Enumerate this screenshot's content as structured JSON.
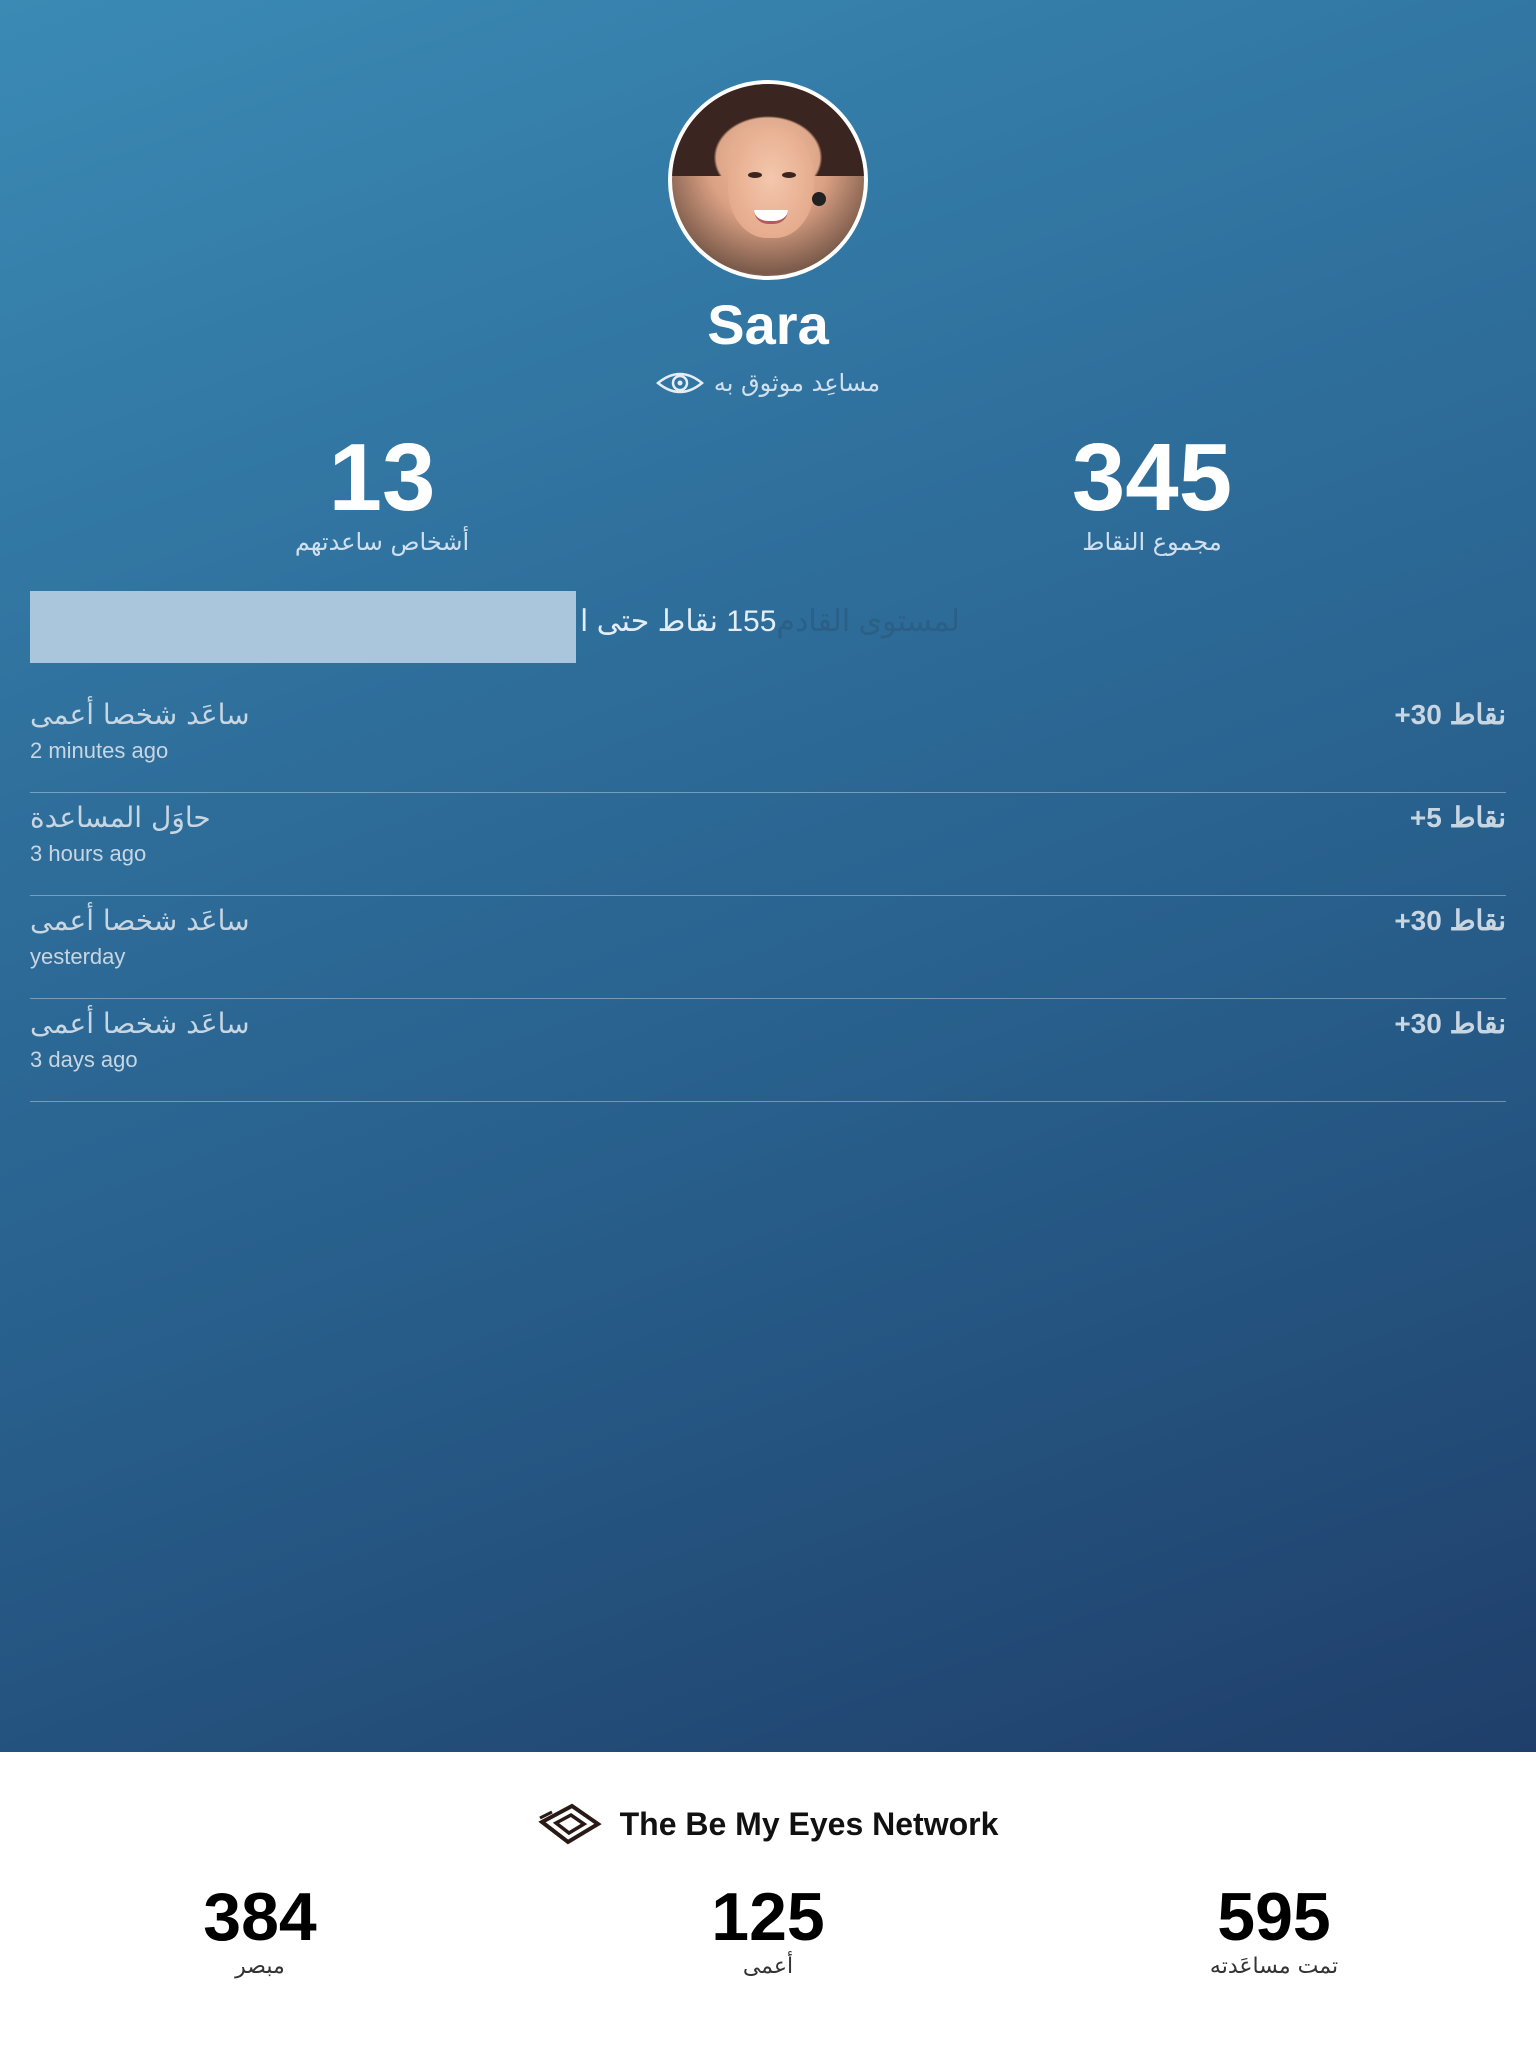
{
  "profile": {
    "name": "Sara",
    "role": "مساعِد موثوق به",
    "helped_count": "13",
    "helped_label": "أشخاص ساعدتهم",
    "points_total": "345",
    "points_label": "مجموع النقاط"
  },
  "progress": {
    "text_before": "155 نقاط حتى ا",
    "text_after": "لمستوى القادم",
    "fraction": 0.37
  },
  "activity": [
    {
      "title": "ساعَد شخصا أعمى",
      "time": "2 minutes ago",
      "points": "+30 نقاط"
    },
    {
      "title": "حاوَل المساعدة",
      "time": "3 hours ago",
      "points": "+5 نقاط"
    },
    {
      "title": "ساعَد شخصا أعمى",
      "time": "yesterday",
      "points": "+30 نقاط"
    },
    {
      "title": "ساعَد شخصا أعمى",
      "time": "3 days ago",
      "points": "+30 نقاط"
    }
  ],
  "network": {
    "title": "The Be My Eyes Network",
    "stats": [
      {
        "value": "384",
        "label": "مبصر"
      },
      {
        "value": "125",
        "label": "أعمى"
      },
      {
        "value": "595",
        "label": "تمت مساعَدته"
      }
    ]
  },
  "colors": {
    "gradient_top": "#3a8ab5",
    "gradient_bottom": "#1f3f6a",
    "progress_fill": "#a9c6dc"
  },
  "icons": [
    "avatar-photo",
    "eye-icon",
    "be-my-eyes-logo"
  ]
}
